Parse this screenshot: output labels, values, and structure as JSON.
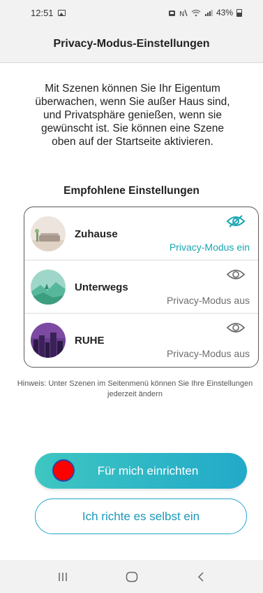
{
  "status_bar": {
    "time": "12:51",
    "battery": "43%",
    "icons": [
      "gallery-icon",
      "alarm-icon",
      "mute-icon",
      "wifi-icon",
      "signal-icon",
      "battery-icon"
    ]
  },
  "header": {
    "title": "Privacy-Modus-Einstellungen"
  },
  "intro": "Mit Szenen können Sie Ihr Eigentum überwachen, wenn Sie außer Haus sind, und Privatsphäre genießen, wenn sie gewünscht ist. Sie können eine Szene oben auf der Startseite aktivieren.",
  "section_title": "Empfohlene Einstellungen",
  "scenes": [
    {
      "name": "Zuhause",
      "status": "Privacy-Modus ein",
      "privacy_on": true,
      "icon": "eye-slash-icon"
    },
    {
      "name": "Unterwegs",
      "status": "Privacy-Modus aus",
      "privacy_on": false,
      "icon": "eye-icon"
    },
    {
      "name": "RUHE",
      "status": "Privacy-Modus aus",
      "privacy_on": false,
      "icon": "eye-icon"
    }
  ],
  "hint": "Hinweis: Unter Szenen im Seitenmenü können Sie Ihre Einstellungen jederzeit ändern",
  "buttons": {
    "primary": "Für mich einrichten",
    "secondary": "Ich richte es selbst ein"
  },
  "colors": {
    "accent": "#1aa6b2",
    "primary_gradient_start": "#3ec6c2",
    "primary_gradient_end": "#22a9c9",
    "status_off": "#6e6e6e"
  },
  "nav_bar": {
    "icons": [
      "recent-apps-icon",
      "home-icon",
      "back-icon"
    ]
  }
}
